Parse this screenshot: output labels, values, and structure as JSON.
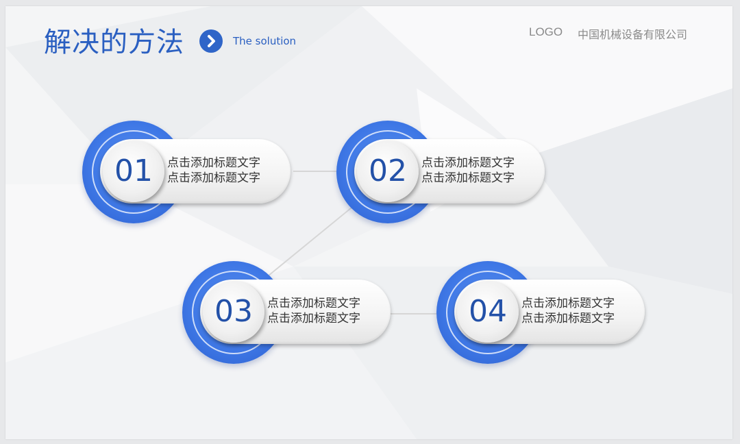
{
  "header": {
    "title": "解决的方法",
    "subtitle": "The solution",
    "logo": "LOGO",
    "company": "中国机械设备有限公司",
    "title_icon": "chevron-right-icon"
  },
  "colors": {
    "accent": "#2a5fc1",
    "ring": "#3f78e6",
    "text": "#333333",
    "muted": "#8a8a8a"
  },
  "items": [
    {
      "number": "01",
      "line1": "点击添加标题文字",
      "line2": "点击添加标题文字"
    },
    {
      "number": "02",
      "line1": "点击添加标题文字",
      "line2": "点击添加标题文字"
    },
    {
      "number": "03",
      "line1": "点击添加标题文字",
      "line2": "点击添加标题文字"
    },
    {
      "number": "04",
      "line1": "点击添加标题文字",
      "line2": "点击添加标题文字"
    }
  ]
}
